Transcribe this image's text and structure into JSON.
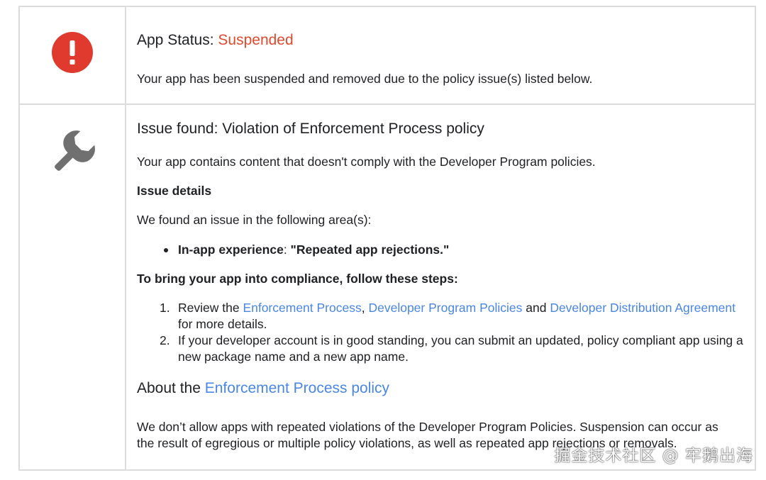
{
  "status_section": {
    "title_prefix": "App Status: ",
    "status_value": "Suspended",
    "status_color": "#e0492f",
    "description": "Your app has been suspended and removed due to the policy issue(s) listed below."
  },
  "issue_section": {
    "title": "Issue found: Violation of Enforcement Process policy",
    "summary": "Your app contains content that doesn't comply with the Developer Program policies.",
    "details_heading": "Issue details",
    "found_text": "We found an issue in the following area(s):",
    "issues": [
      {
        "label": "In-app experience",
        "separator": ": ",
        "value": "\"Repeated app rejections.\""
      }
    ],
    "steps_heading": "To bring your app into compliance, follow these steps:",
    "steps": [
      {
        "number": "1.",
        "prefix": "Review the ",
        "link1": "Enforcement Process",
        "sep1": ", ",
        "link2": "Developer Program Policies",
        "sep2": " and ",
        "link3": "Developer Distribution Agreement",
        "suffix": " for more details."
      },
      {
        "number": "2.",
        "text": "If your developer account is in good standing, you can submit an updated, policy compliant app using a new package name and a new app name."
      }
    ],
    "about_prefix": "About the ",
    "about_link": "Enforcement Process policy",
    "about_text": "We don’t allow apps with repeated violations of the Developer Program Policies. Suspension can occur as the result of egregious or multiple policy violations, as well as repeated app rejections or removals."
  },
  "icons": {
    "status": "alert-circle-icon",
    "issue": "wrench-icon"
  },
  "colors": {
    "link": "#4a86e8",
    "alert_red": "#e03a2f",
    "wrench_gray": "#707070",
    "border": "#dcdcdc"
  },
  "watermark": "掘金技术社区 @ 牢鹅出海"
}
